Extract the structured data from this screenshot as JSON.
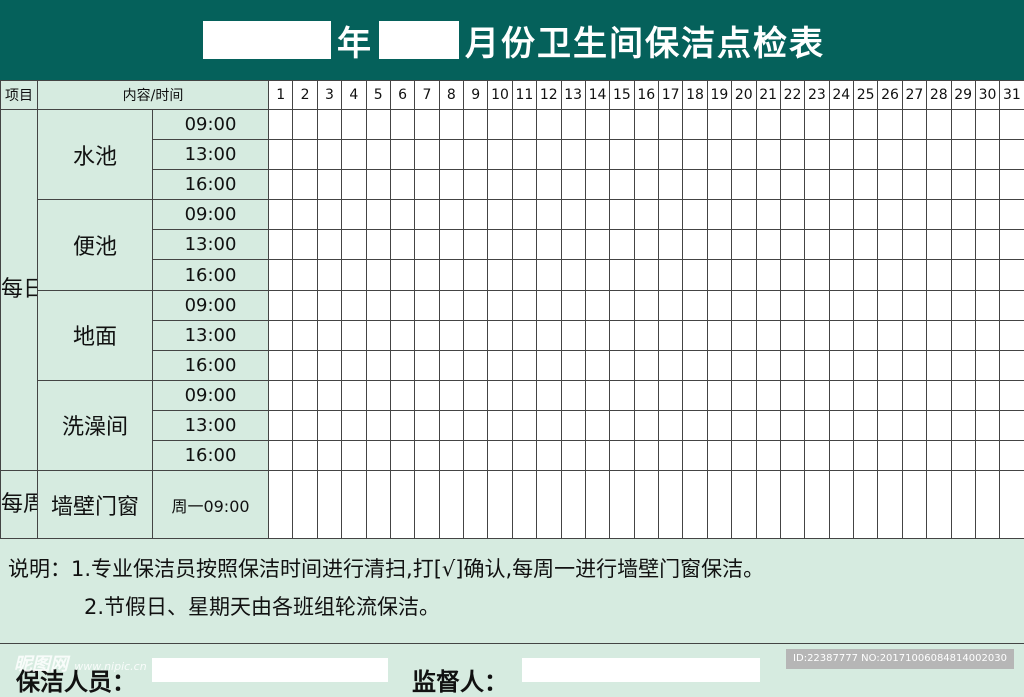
{
  "title": {
    "year_label": "年",
    "rest": "月份卫生间保洁点检表"
  },
  "header": {
    "item_label": "项目",
    "content_label": "内容/时间",
    "days": [
      "1",
      "2",
      "3",
      "4",
      "5",
      "6",
      "7",
      "8",
      "9",
      "10",
      "11",
      "12",
      "13",
      "14",
      "15",
      "16",
      "17",
      "18",
      "19",
      "20",
      "21",
      "22",
      "23",
      "24",
      "25",
      "26",
      "27",
      "28",
      "29",
      "30",
      "31"
    ]
  },
  "daily": {
    "label": "每日",
    "areas": [
      {
        "name": "水池",
        "times": [
          "09:00",
          "13:00",
          "16:00"
        ]
      },
      {
        "name": "便池",
        "times": [
          "09:00",
          "13:00",
          "16:00"
        ]
      },
      {
        "name": "地面",
        "times": [
          "09:00",
          "13:00",
          "16:00"
        ]
      },
      {
        "name": "洗澡间",
        "times": [
          "09:00",
          "13:00",
          "16:00"
        ]
      }
    ]
  },
  "weekly": {
    "label": "每周",
    "area": "墙壁门窗",
    "time": "周一09:00"
  },
  "notes": {
    "line1": "说明：1.专业保洁员按照保洁时间进行清扫,打[√]确认,每周一进行墙壁门窗保洁。",
    "line2": "2.节假日、星期天由各班组轮流保洁。"
  },
  "footer": {
    "cleaner_label": "保洁人员：",
    "supervisor_label": "监督人："
  },
  "watermark": {
    "logo": "昵图网",
    "url": "www.nipic.cn",
    "id_text": "ID:22387777 NO:20171006084814002030"
  },
  "colors": {
    "header_bg": "#05615b",
    "panel_bg": "#d6ebe0"
  }
}
